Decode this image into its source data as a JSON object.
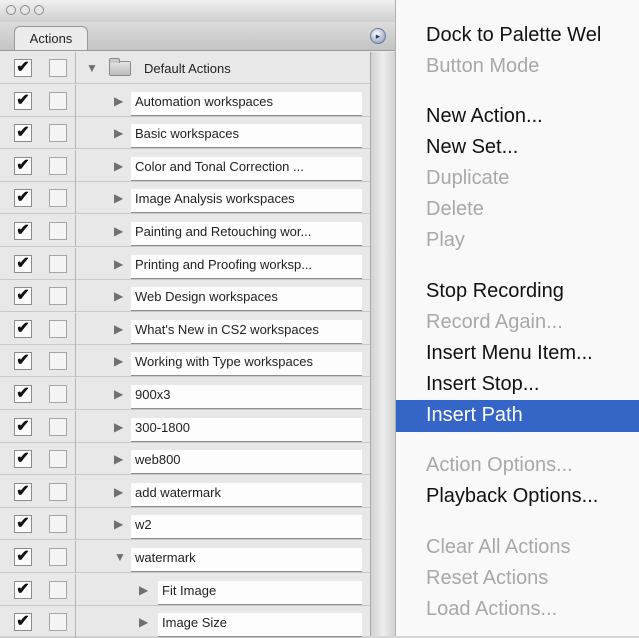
{
  "palette": {
    "tab_label": "Actions",
    "menu_button_icon": "palette-menu-arrow-icon",
    "rows": [
      {
        "label": "Default Actions",
        "checked": true,
        "indent": 0,
        "expanded": true,
        "kind": "set"
      },
      {
        "label": "Automation workspaces",
        "checked": true,
        "indent": 1,
        "expanded": false,
        "kind": "action"
      },
      {
        "label": "Basic workspaces",
        "checked": true,
        "indent": 1,
        "expanded": false,
        "kind": "action"
      },
      {
        "label": "Color and Tonal Correction ...",
        "checked": true,
        "indent": 1,
        "expanded": false,
        "kind": "action"
      },
      {
        "label": "Image Analysis workspaces",
        "checked": true,
        "indent": 1,
        "expanded": false,
        "kind": "action"
      },
      {
        "label": "Painting and Retouching wor...",
        "checked": true,
        "indent": 1,
        "expanded": false,
        "kind": "action"
      },
      {
        "label": "Printing and Proofing worksp...",
        "checked": true,
        "indent": 1,
        "expanded": false,
        "kind": "action"
      },
      {
        "label": "Web Design workspaces",
        "checked": true,
        "indent": 1,
        "expanded": false,
        "kind": "action"
      },
      {
        "label": "What's New in CS2 workspaces",
        "checked": true,
        "indent": 1,
        "expanded": false,
        "kind": "action"
      },
      {
        "label": "Working with Type workspaces",
        "checked": true,
        "indent": 1,
        "expanded": false,
        "kind": "action"
      },
      {
        "label": "900x3",
        "checked": true,
        "indent": 1,
        "expanded": false,
        "kind": "action"
      },
      {
        "label": "300-1800",
        "checked": true,
        "indent": 1,
        "expanded": false,
        "kind": "action"
      },
      {
        "label": "web800",
        "checked": true,
        "indent": 1,
        "expanded": false,
        "kind": "action"
      },
      {
        "label": "add watermark",
        "checked": true,
        "indent": 1,
        "expanded": false,
        "kind": "action"
      },
      {
        "label": "w2",
        "checked": true,
        "indent": 1,
        "expanded": false,
        "kind": "action"
      },
      {
        "label": "watermark",
        "checked": true,
        "indent": 1,
        "expanded": true,
        "kind": "action"
      },
      {
        "label": "Fit Image",
        "checked": true,
        "indent": 2,
        "expanded": false,
        "kind": "step"
      },
      {
        "label": "Image Size",
        "checked": true,
        "indent": 2,
        "expanded": false,
        "kind": "step"
      }
    ]
  },
  "menu": {
    "items": [
      {
        "label": "Dock to Palette Wel",
        "enabled": true,
        "highlighted": false
      },
      {
        "label": "Button Mode",
        "enabled": false,
        "highlighted": false
      },
      {
        "label": "New Action...",
        "enabled": true,
        "highlighted": false
      },
      {
        "label": "New Set...",
        "enabled": true,
        "highlighted": false
      },
      {
        "label": "Duplicate",
        "enabled": false,
        "highlighted": false
      },
      {
        "label": "Delete",
        "enabled": false,
        "highlighted": false
      },
      {
        "label": "Play",
        "enabled": false,
        "highlighted": false
      },
      {
        "label": "Stop Recording",
        "enabled": true,
        "highlighted": false
      },
      {
        "label": "Record Again...",
        "enabled": false,
        "highlighted": false
      },
      {
        "label": "Insert Menu Item...",
        "enabled": true,
        "highlighted": false
      },
      {
        "label": "Insert Stop...",
        "enabled": true,
        "highlighted": false
      },
      {
        "label": "Insert Path",
        "enabled": true,
        "highlighted": true
      },
      {
        "label": "Action Options...",
        "enabled": false,
        "highlighted": false
      },
      {
        "label": "Playback Options...",
        "enabled": true,
        "highlighted": false
      },
      {
        "label": "Clear All Actions",
        "enabled": false,
        "highlighted": false
      },
      {
        "label": "Reset Actions",
        "enabled": false,
        "highlighted": false
      },
      {
        "label": "Load Actions...",
        "enabled": false,
        "highlighted": false
      }
    ],
    "highlight_color": "#3465c7"
  },
  "icons": {
    "checkmark": "checkmark-icon",
    "expand_open": "disclosure-open-icon",
    "expand_closed": "disclosure-closed-icon",
    "folder": "folder-icon",
    "cursor": "mouse-pointer-icon"
  }
}
